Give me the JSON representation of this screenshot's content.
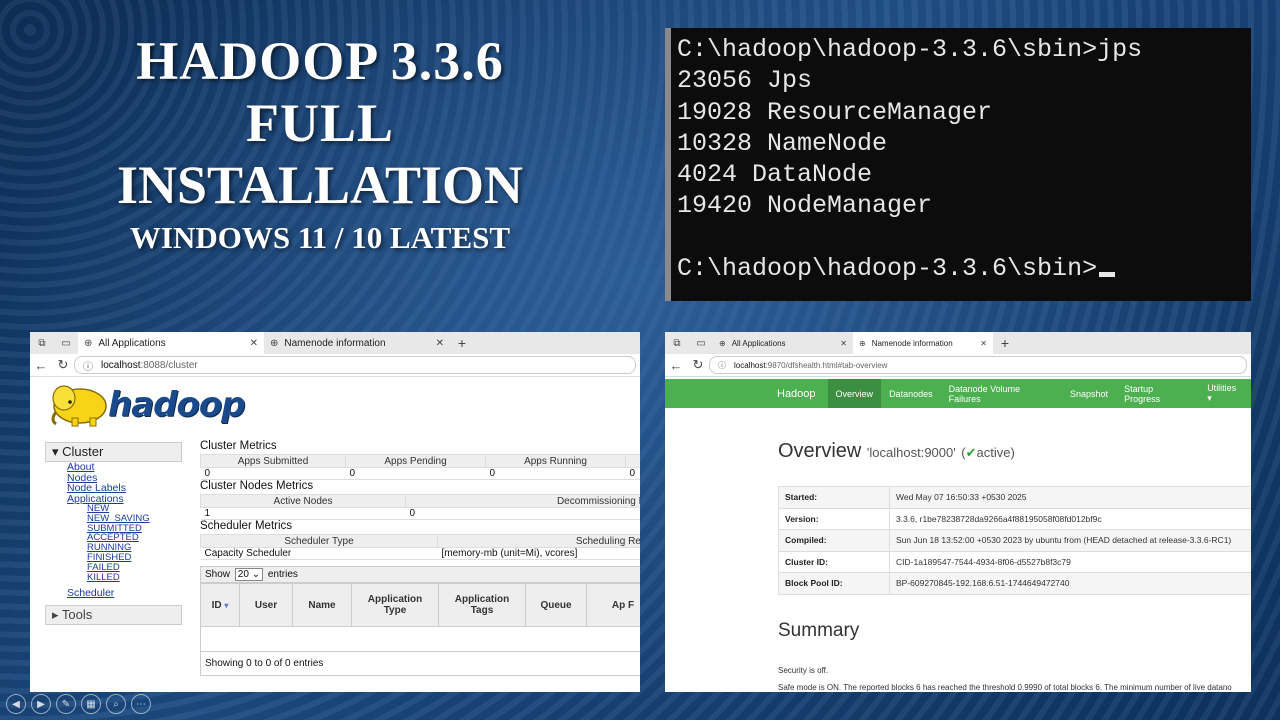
{
  "slide": {
    "title_line1": "HADOOP 3.3.6",
    "title_line2": "FULL",
    "title_line3": "INSTALLATION",
    "subtitle": "WINDOWS 11 / 10 LATEST"
  },
  "terminal": {
    "lines": [
      "C:\\hadoop\\hadoop-3.3.6\\sbin>jps",
      "23056 Jps",
      "19028 ResourceManager",
      "10328 NameNode",
      "4024 DataNode",
      "19420 NodeManager"
    ],
    "prompt": "C:\\hadoop\\hadoop-3.3.6\\sbin>"
  },
  "cluster_window": {
    "tabs": [
      {
        "label": "All Applications"
      },
      {
        "label": "Namenode information"
      }
    ],
    "url_host": "localhost",
    "url_path": ":8088/cluster",
    "logo_text": "hadoop",
    "sidebar": {
      "cluster_label": "Cluster",
      "links": [
        "About",
        "Nodes",
        "Node Labels",
        "Applications"
      ],
      "app_states": [
        "NEW",
        "NEW_SAVING",
        "SUBMITTED",
        "ACCEPTED",
        "RUNNING",
        "FINISHED",
        "FAILED",
        "KILLED"
      ],
      "scheduler_link": "Scheduler",
      "tools_label": "Tools"
    },
    "cluster_metrics": {
      "title": "Cluster Metrics",
      "headers": [
        "Apps Submitted",
        "Apps Pending",
        "Apps Running"
      ],
      "values": [
        "0",
        "0",
        "0",
        "0"
      ]
    },
    "node_metrics": {
      "title": "Cluster Nodes Metrics",
      "headers": [
        "Active Nodes",
        "Decommissioning Nod"
      ],
      "values": [
        "1",
        "0"
      ]
    },
    "scheduler_metrics": {
      "title": "Scheduler Metrics",
      "headers": [
        "Scheduler Type",
        "Scheduling Resou"
      ],
      "values": [
        "Capacity Scheduler",
        "[memory-mb (unit=Mi), vcores]"
      ]
    },
    "show_entries": {
      "prefix": "Show",
      "value": "20",
      "suffix": "entries"
    },
    "app_table_headers": [
      "ID",
      "User",
      "Name",
      "Application Type",
      "Application Tags",
      "Queue",
      "Ap F"
    ],
    "showing_text": "Showing 0 to 0 of 0 entries"
  },
  "namenode_window": {
    "tabs": [
      {
        "label": "All Applications"
      },
      {
        "label": "Namenode information"
      }
    ],
    "url_host": "localhost",
    "url_path": ":9870/dfshealth.html#tab-overview",
    "nav": [
      "Hadoop",
      "Overview",
      "Datanodes",
      "Datanode Volume Failures",
      "Snapshot",
      "Startup Progress",
      "Utilities ▾"
    ],
    "overview_title": "Overview",
    "overview_host": "'localhost:9000'",
    "overview_status": "active",
    "info_rows": [
      {
        "key": "Started:",
        "value": "Wed May 07 16:50:33 +0530 2025"
      },
      {
        "key": "Version:",
        "value": "3.3.6, r1be78238728da9266a4f88195058f08fd012bf9c"
      },
      {
        "key": "Compiled:",
        "value": "Sun Jun 18 13:52:00 +0530 2023 by ubuntu from (HEAD detached at release-3.3.6-RC1)"
      },
      {
        "key": "Cluster ID:",
        "value": "CID-1a189547-7544-4934-8f06-d5527b8f3c79"
      },
      {
        "key": "Block Pool ID:",
        "value": "BP-609270845-192.168.6.51-1744649472740"
      }
    ],
    "summary_title": "Summary",
    "security_text": "Security is off.",
    "safemode_text": "Safe mode is ON. The reported blocks 6 has reached the threshold 0.9990 of total blocks 6. The minimum number of live datano"
  }
}
